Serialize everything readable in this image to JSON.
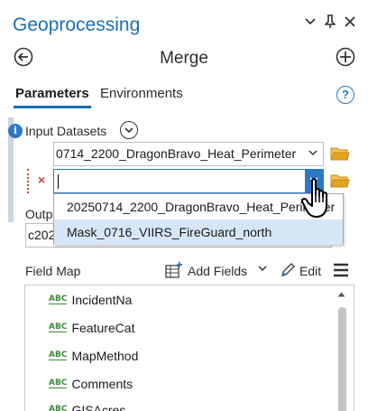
{
  "panel": {
    "title": "Geoprocessing",
    "tool_title": "Merge",
    "icons": {
      "options": "chevron-down-icon",
      "pin": "pin-icon",
      "close": "close-icon",
      "back": "back-arrow-icon",
      "add": "add-icon",
      "help": "help-icon"
    }
  },
  "tabs": [
    {
      "label": "Parameters",
      "active": true
    },
    {
      "label": "Environments",
      "active": false
    }
  ],
  "help_label": "?",
  "info_label": "i",
  "input_datasets": {
    "label": "Input Datasets",
    "rows": [
      {
        "value": "0714_2200_DragonBravo_Heat_Perimeter"
      },
      {
        "value": ""
      }
    ],
    "remove_label": "×"
  },
  "dropdown": {
    "options": [
      {
        "label": "20250714_2200_DragonBravo_Heat_Perimeter",
        "highlighted": false
      },
      {
        "label": "Mask_0716_VIIRS_FireGuard_north",
        "highlighted": true
      }
    ]
  },
  "output": {
    "label": "Outp",
    "value": "c202"
  },
  "field_map": {
    "label": "Field Map",
    "add_fields_label": "Add Fields",
    "edit_label": "Edit",
    "field_type_badge": "ABC",
    "fields": [
      {
        "name": "IncidentNa"
      },
      {
        "name": "FeatureCat"
      },
      {
        "name": "MapMethod"
      },
      {
        "name": "Comments"
      },
      {
        "name": "GISAcres"
      }
    ]
  },
  "colors": {
    "accent": "#1a6fb5",
    "highlight": "#d5e6f6",
    "error": "#d03b3b",
    "folder": "#e0a526",
    "text_field_badge": "#3a8a3a"
  }
}
